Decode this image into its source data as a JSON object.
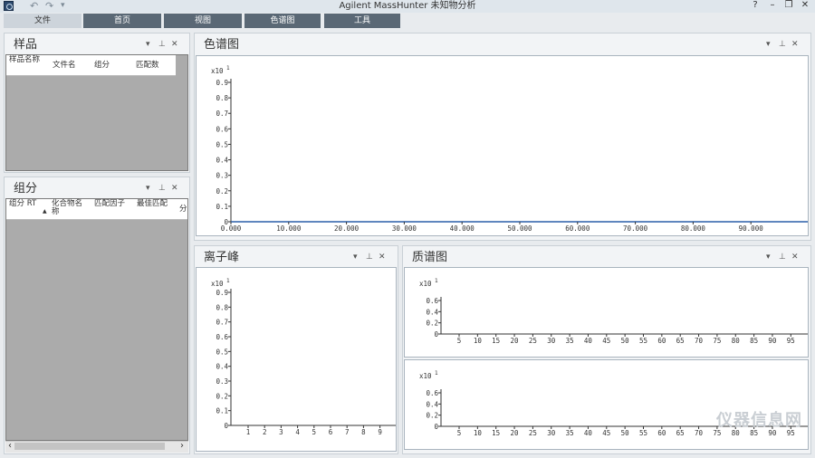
{
  "window": {
    "title": "Agilent MassHunter 未知物分析",
    "help": "?",
    "minimize": "–",
    "restore": "❐",
    "close": "✕"
  },
  "quick_access": {
    "undo": "↶",
    "redo": "↷",
    "more": "▾"
  },
  "ribbon": {
    "tabs": [
      "文件",
      "首页",
      "视图",
      "色谱图",
      "工具"
    ],
    "active": "文件"
  },
  "panel_controls": {
    "dropdown": "▾",
    "pin": "⊥",
    "close": "✕"
  },
  "samples_panel": {
    "title": "样品",
    "columns": [
      "样品名称",
      "文件名",
      "组分",
      "匹配数"
    ]
  },
  "components_panel": {
    "title": "组分",
    "columns": [
      "组分 RT",
      "化合物名称",
      "匹配因子",
      "最佳匹配",
      "分"
    ],
    "scroll_left": "‹",
    "scroll_right": "›"
  },
  "chromatogram_panel": {
    "title": "色谱图",
    "scale_label": "x10",
    "scale_exp": "1",
    "y_ticks": [
      "0.9",
      "0.8",
      "0.7",
      "0.6",
      "0.5",
      "0.4",
      "0.3",
      "0.2",
      "0.1",
      "0"
    ],
    "x_ticks": [
      "0.000",
      "10.000",
      "20.000",
      "30.000",
      "40.000",
      "50.000",
      "60.000",
      "70.000",
      "80.000",
      "90.000"
    ]
  },
  "ion_peaks_panel": {
    "title": "离子峰",
    "scale_label": "x10",
    "scale_exp": "1",
    "y_ticks": [
      "0.9",
      "0.8",
      "0.7",
      "0.6",
      "0.5",
      "0.4",
      "0.3",
      "0.2",
      "0.1",
      "0"
    ],
    "x_ticks": [
      "1",
      "2",
      "3",
      "4",
      "5",
      "6",
      "7",
      "8",
      "9"
    ]
  },
  "mass_spectrum_panel": {
    "title": "质谱图",
    "scale_label": "x10",
    "scale_exp": "1",
    "y_ticks": [
      "0.6",
      "0.4",
      "0.2",
      "0"
    ],
    "x_ticks": [
      "5",
      "10",
      "15",
      "20",
      "25",
      "30",
      "35",
      "40",
      "45",
      "50",
      "55",
      "60",
      "65",
      "70",
      "75",
      "80",
      "85",
      "90",
      "95"
    ]
  },
  "watermark": "仪器信息网",
  "colors": {
    "tab_bg": "#5a6875",
    "tab_active": "#cdd4db",
    "grid_gray": "#ababab",
    "baseline_blue": "#2a5fa8"
  }
}
